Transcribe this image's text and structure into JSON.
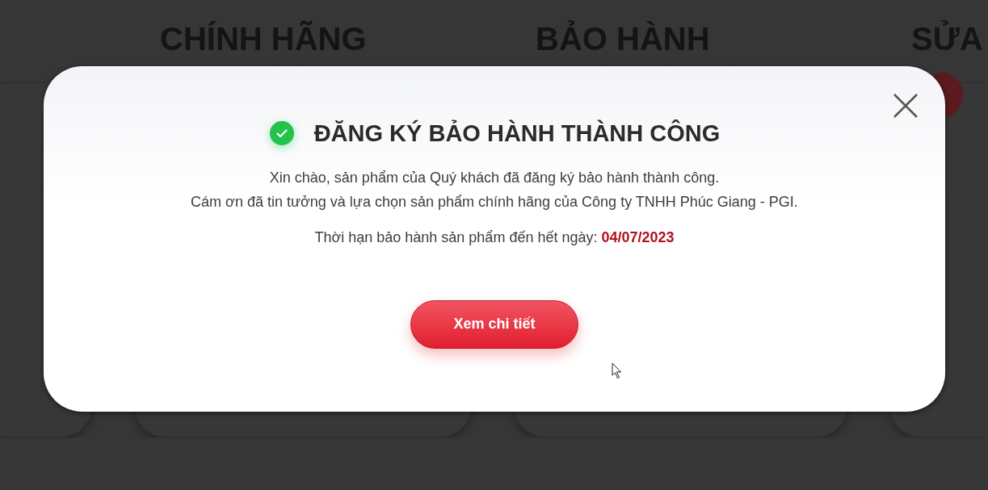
{
  "background": {
    "headings": [
      "CHÍNH HÃNG",
      "BẢO HÀNH",
      "SỬA"
    ]
  },
  "dialog": {
    "title": "ĐĂNG KÝ BẢO HÀNH THÀNH CÔNG",
    "message_lines": [
      "Xin chào, sản phẩm của Quý khách đã đăng ký bảo hành thành công.",
      "Cám ơn đã tin tưởng và lựa chọn sản phẩm chính hãng của Công ty TNHH Phúc Giang - PGI."
    ],
    "expiry_label": "Thời hạn bảo hành sản phẩm đến hết ngày:",
    "expiry_date": "04/07/2023",
    "button": "Xem chi tiết"
  }
}
